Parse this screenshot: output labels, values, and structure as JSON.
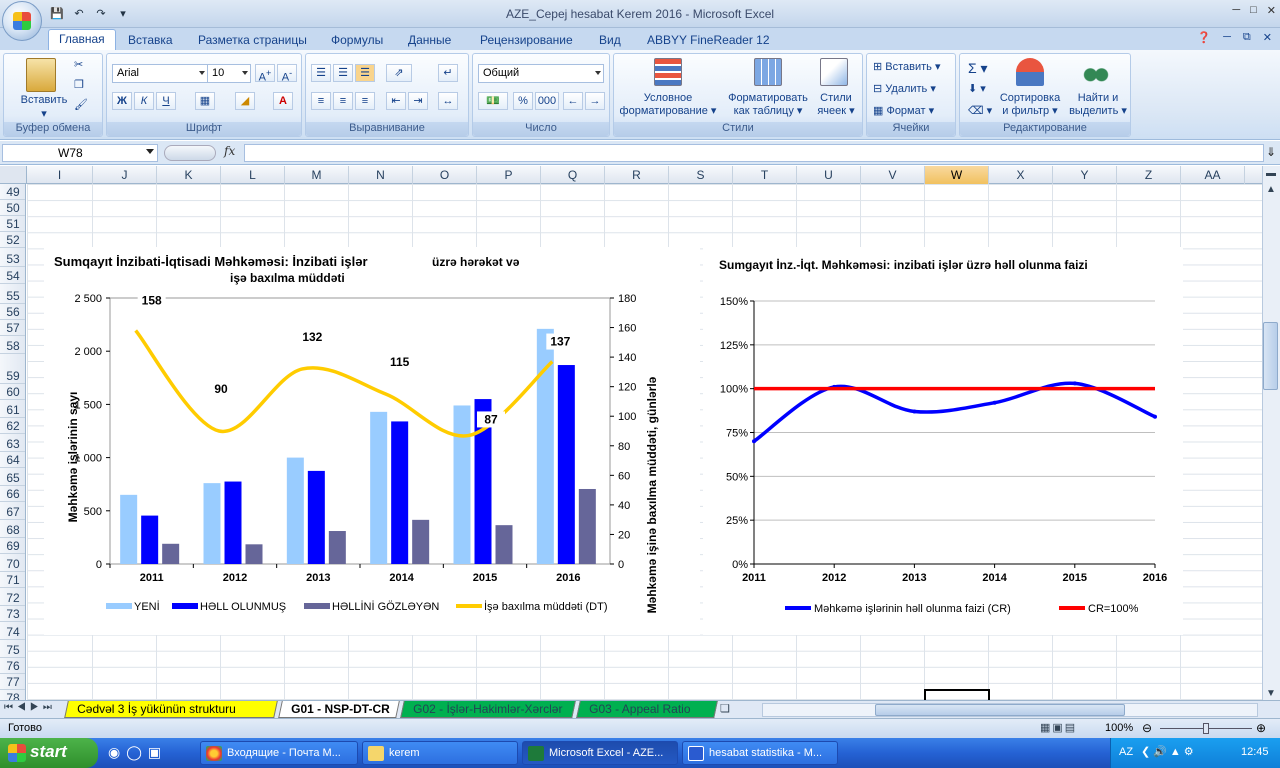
{
  "window": {
    "title": "AZE_Cepej hesabat Kerem 2016 - Microsoft Excel"
  },
  "ribbon_tabs": [
    "Главная",
    "Вставка",
    "Разметка страницы",
    "Формулы",
    "Данные",
    "Рецензирование",
    "Вид",
    "ABBYY FineReader 12"
  ],
  "ribbon": {
    "clipboard": {
      "label": "Буфер обмена",
      "paste": "Вставить"
    },
    "font": {
      "label": "Шрифт",
      "name": "Arial",
      "size": "10",
      "bold": "Ж",
      "italic": "К",
      "underline": "Ч"
    },
    "alignment": {
      "label": "Выравнивание"
    },
    "number": {
      "label": "Число",
      "format": "Общий",
      "percent": "%",
      "thousands": "000"
    },
    "styles": {
      "label": "Стили",
      "cond_1": "Условное",
      "cond_2": "форматирование",
      "table_1": "Форматировать",
      "table_2": "как таблицу",
      "cell_1": "Стили",
      "cell_2": "ячеек"
    },
    "cells": {
      "label": "Ячейки",
      "insert": "Вставить",
      "delete": "Удалить",
      "format": "Формат"
    },
    "editing": {
      "label": "Редактирование",
      "sort_1": "Сортировка",
      "sort_2": "и фильтр",
      "find_1": "Найти и",
      "find_2": "выделить"
    }
  },
  "formula_bar": {
    "name_box": "W78",
    "fx": "fx",
    "value": ""
  },
  "columns": [
    "I",
    "J",
    "K",
    "L",
    "M",
    "N",
    "O",
    "P",
    "Q",
    "R",
    "S",
    "T",
    "U",
    "V",
    "W",
    "X",
    "Y",
    "Z",
    "AA"
  ],
  "selected_column": "W",
  "rows": [
    "49",
    "50",
    "51",
    "52",
    "53",
    "54",
    "55",
    "56",
    "57",
    "58",
    "59",
    "60",
    "61",
    "62",
    "63",
    "64",
    "65",
    "66",
    "67",
    "68",
    "69",
    "70",
    "71",
    "72",
    "73",
    "74",
    "75",
    "76",
    "77",
    "78"
  ],
  "chart_data": [
    {
      "type": "bar",
      "title_1": "Sumqayıt İnzibati-İqtisadi  Məhkəməsi:  İnzibati  işlər",
      "title_2": "üzrə hərəkət və",
      "title_3": "işə baxılma müddəti",
      "categories": [
        "2011",
        "2012",
        "2013",
        "2014",
        "2015",
        "2016"
      ],
      "ylabel": "Məhkəmə işlərinin sayı",
      "y2label": "Məhkəmə işinə baxılma müddəti, günlərlə",
      "ylim": [
        0,
        2500
      ],
      "y2lim": [
        0,
        180
      ],
      "yticks": [
        "0",
        "500",
        "1 000",
        "1 500",
        "2 000",
        "2 500"
      ],
      "y2ticks": [
        "0",
        "20",
        "40",
        "60",
        "80",
        "100",
        "120",
        "140",
        "160",
        "180"
      ],
      "series": [
        {
          "name": "YENİ",
          "color": "#99ccff",
          "values": [
            650,
            760,
            1000,
            1430,
            1490,
            2210
          ]
        },
        {
          "name": "HƏLL OLUNMUŞ",
          "color": "#0000ff",
          "values": [
            455,
            775,
            875,
            1340,
            1550,
            1870
          ]
        },
        {
          "name": "HƏLLİNİ GÖZLƏYƏN",
          "color": "#666699",
          "values": [
            190,
            185,
            310,
            415,
            365,
            705
          ]
        }
      ],
      "line": {
        "name": "İşə baxılma müddəti (DT)",
        "color": "#ffcc00",
        "values": [
          158,
          90,
          132,
          115,
          87,
          137
        ]
      },
      "line_labels": [
        "158",
        "90",
        "132",
        "115",
        "87",
        "137"
      ]
    },
    {
      "type": "line",
      "title": "Sumgayıt İnz.-İqt. Məhkəməsi:  inzibati işlər üzrə həll olunma faizi",
      "categories": [
        "2011",
        "2012",
        "2013",
        "2014",
        "2015",
        "2016"
      ],
      "ylim": [
        0,
        150
      ],
      "yticks": [
        "0%",
        "25%",
        "50%",
        "75%",
        "100%",
        "125%",
        "150%"
      ],
      "series": [
        {
          "name": "Məhkəmə işlərinin həll olunma faizi (CR)",
          "color": "#0000ff",
          "values": [
            70,
            101,
            87,
            92,
            103,
            84
          ]
        },
        {
          "name": "CR=100%",
          "color": "#ff0000",
          "values": [
            100,
            100,
            100,
            100,
            100,
            100
          ]
        }
      ]
    }
  ],
  "sheet_tabs": [
    "Cədvəl 3 İş yükünün strukturu",
    "G01 - NSP-DT-CR",
    "G02 - İşlər-Hakimlər-Xərclər",
    "G03 - Appeal Ratio"
  ],
  "active_sheet": "G01 - NSP-DT-CR",
  "status": {
    "ready": "Готово",
    "zoom": "100%"
  },
  "taskbar": {
    "start": "start",
    "items": [
      "Входящие - Почта M...",
      "kerem",
      "Microsoft Excel - AZE...",
      "hesabat statistika - M..."
    ],
    "lang": "AZ",
    "clock": "12:45"
  }
}
